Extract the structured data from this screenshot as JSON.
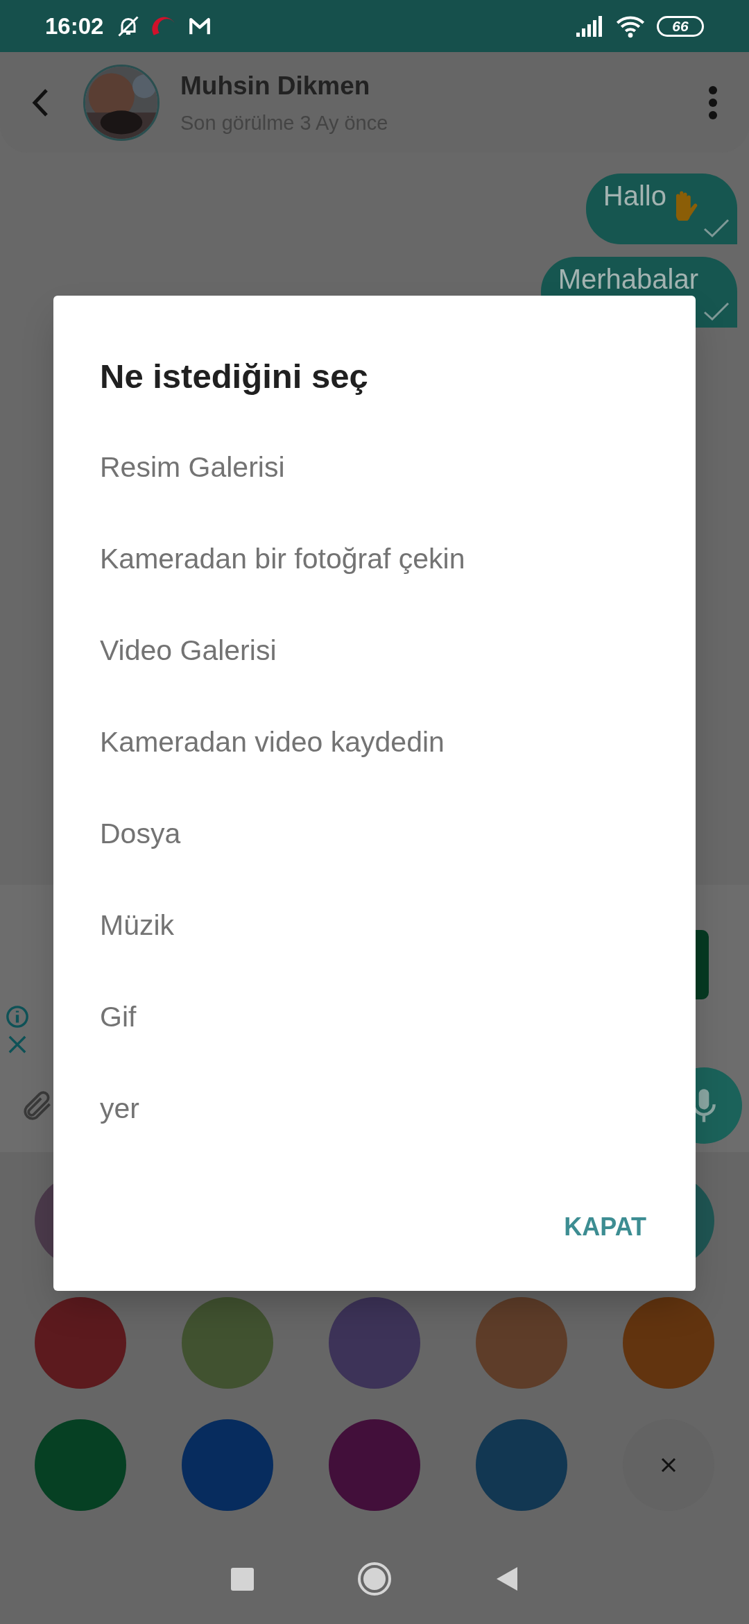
{
  "status_bar": {
    "time": "16:02",
    "battery": "66"
  },
  "chat_header": {
    "name": "Muhsin Dikmen",
    "status": "Son görülme 3 Ay önce"
  },
  "messages": [
    {
      "text": "Hallo",
      "emoji": true
    },
    {
      "text": "Merhabalar",
      "emoji": false
    }
  ],
  "dialog": {
    "title": "Ne istediğini seç",
    "options": [
      "Resim Galerisi",
      "Kameradan bir fotoğraf çekin",
      "Video Galerisi",
      "Kameradan video kaydedin",
      "Dosya",
      "Müzik",
      "Gif",
      "yer"
    ],
    "button": "KAPAT"
  },
  "swatch_rows": [
    [
      {
        "kind": "swatch",
        "color": "#4b3a4b"
      },
      {
        "kind": "swatch",
        "color": "#1f5553"
      }
    ],
    [
      {
        "kind": "swatch",
        "color": "#5c1a1e"
      },
      {
        "kind": "swatch",
        "color": "#415230"
      },
      {
        "kind": "swatch",
        "color": "#3d3358"
      },
      {
        "kind": "swatch",
        "color": "#5e3d29"
      },
      {
        "kind": "swatch",
        "color": "#62340f"
      }
    ],
    [
      {
        "kind": "swatch",
        "color": "#064023"
      },
      {
        "kind": "swatch",
        "color": "#072c5e"
      },
      {
        "kind": "swatch",
        "color": "#420f3a"
      },
      {
        "kind": "swatch",
        "color": "#123752"
      },
      {
        "kind": "close"
      }
    ]
  ]
}
